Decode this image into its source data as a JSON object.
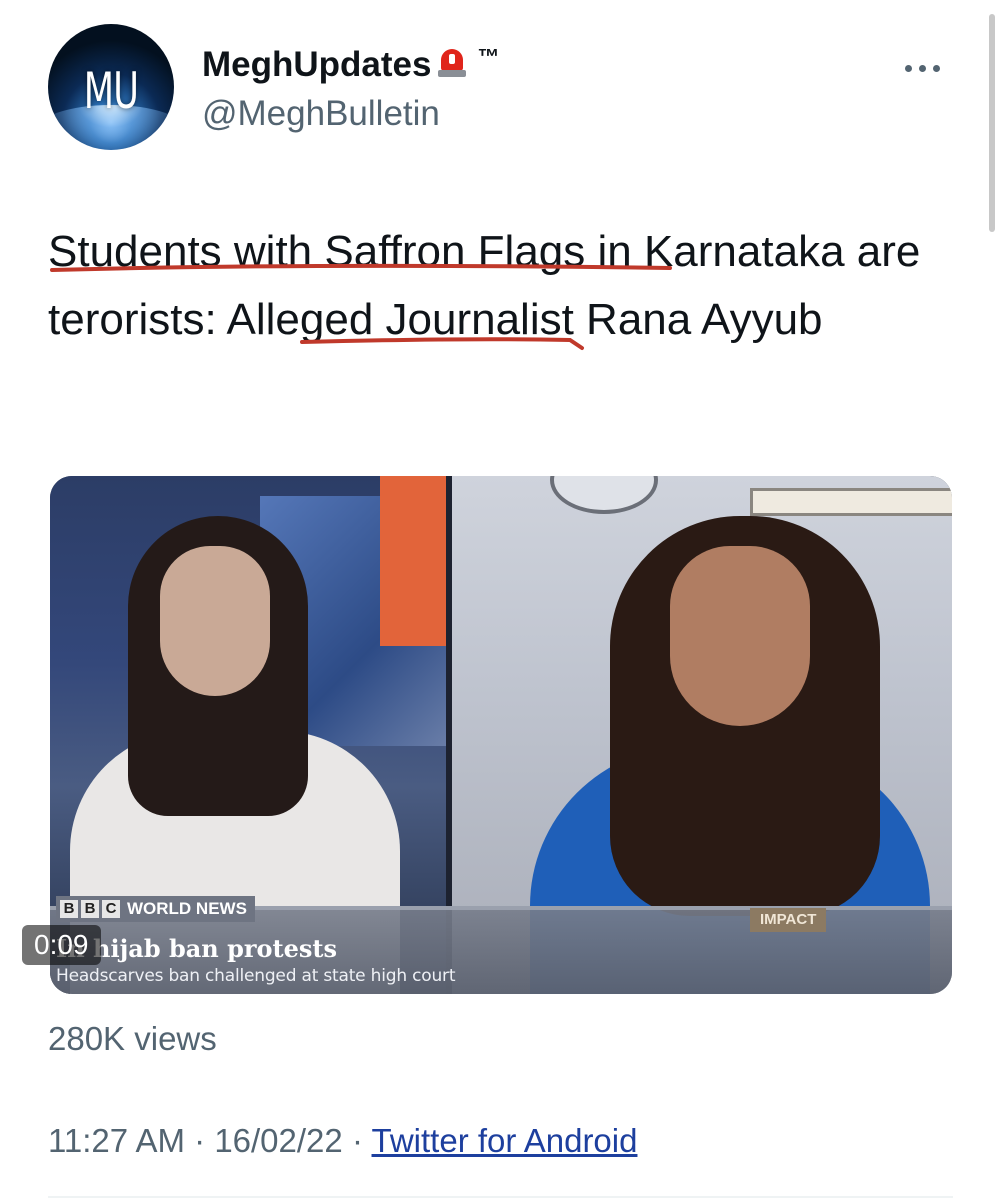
{
  "author": {
    "display_name": "MeghUpdates",
    "badge_icon": "police-light-icon",
    "trademark": "™",
    "handle": "@MeghBulletin",
    "avatar_text": "MU"
  },
  "menu": {
    "icon": "more-horizontal-icon"
  },
  "tweet": {
    "text_part1": "Students with Saffron Flags in Karnataka ",
    "text_part2": "are terorists",
    "text_part3": ": Alleged Journalist Rana Ayyub",
    "annotation_color": "#c0392b"
  },
  "video": {
    "duration": "0:09",
    "broadcaster_letters": [
      "B",
      "B",
      "C"
    ],
    "channel_name": "WORLD NEWS",
    "segment_tag": "IMPACT",
    "headline": "In hijab ban protests",
    "subheadline": "Headscarves ban challenged at state high court"
  },
  "stats": {
    "views": "280K views"
  },
  "meta": {
    "time": "11:27 AM",
    "separator": " · ",
    "date": "16/02/22",
    "source": "Twitter for Android"
  },
  "colors": {
    "text_primary": "#0f1419",
    "text_secondary": "#536471",
    "link": "#1d3f9e",
    "siren_red": "#e0251b"
  }
}
